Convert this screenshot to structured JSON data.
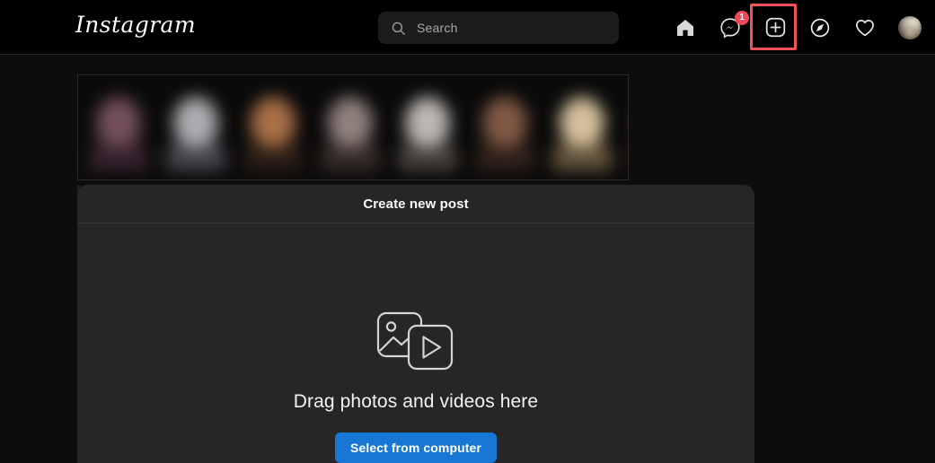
{
  "colors": {
    "page_bg": "#0d0d0d",
    "nav_bg": "#000000",
    "modal_bg": "#262626",
    "accent_blue": "#1877d4",
    "badge_red": "#ed4956",
    "highlight_red": "#f4505a"
  },
  "navbar": {
    "logo": "Instagram",
    "search": {
      "placeholder": "Search",
      "value": "",
      "icon": "search-icon"
    },
    "icons": [
      {
        "name": "home-icon",
        "label": "Home",
        "badge": null
      },
      {
        "name": "messenger-icon",
        "label": "Messages",
        "badge": "1"
      },
      {
        "name": "create-post-icon",
        "label": "New post",
        "badge": null,
        "highlighted": true
      },
      {
        "name": "explore-compass-icon",
        "label": "Explore",
        "badge": null
      },
      {
        "name": "heart-icon",
        "label": "Notifications",
        "badge": null
      },
      {
        "name": "profile-avatar",
        "label": "Profile",
        "badge": null
      }
    ]
  },
  "stories": {
    "count": 8,
    "items": [
      {
        "face": "#7a5560",
        "body": "#3a2430"
      },
      {
        "face": "#b9b9bd",
        "body": "#4a4a52"
      },
      {
        "face": "#b5784c",
        "body": "#2e2018"
      },
      {
        "face": "#9a8a86",
        "body": "#3a2f2c"
      },
      {
        "face": "#c9c4c0",
        "body": "#4b4540"
      },
      {
        "face": "#8a5f4a",
        "body": "#33231c"
      },
      {
        "face": "#e3cfa8",
        "body": "#6a5a40"
      },
      {
        "face": "#a8524e",
        "body": "#3c1f1e"
      }
    ]
  },
  "modal": {
    "title": "Create new post",
    "media_icon": "photo-video-icon",
    "drag_text": "Drag photos and videos here",
    "select_button": "Select from computer"
  }
}
